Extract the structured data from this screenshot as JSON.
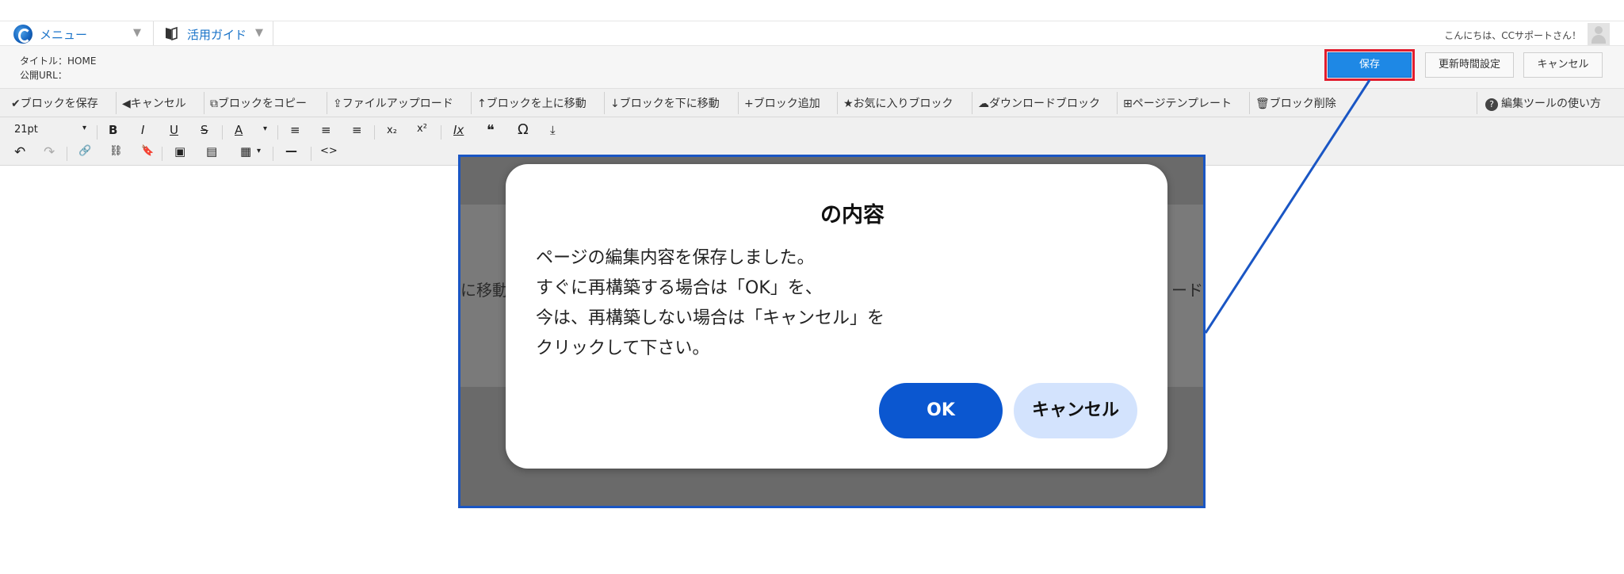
{
  "topbar": {
    "menu_label": "メニュー",
    "guide_label": "活用ガイド",
    "caret": "▼",
    "greeting": "こんにちは、CCサポートさん！"
  },
  "page_info": {
    "title_line": "タイトル：HOME",
    "url_line": "公開URL："
  },
  "actions": {
    "save": "保存",
    "update_time": "更新時間設定",
    "cancel": "キャンセル"
  },
  "block_toolbar": {
    "items": [
      {
        "icon": "✔",
        "label": "ブロックを保存"
      },
      {
        "icon": "◀",
        "label": "キャンセル"
      },
      {
        "icon": "⧉",
        "label": "ブロックをコピー"
      },
      {
        "icon": "⇪",
        "label": "ファイルアップロード"
      },
      {
        "icon": "↑",
        "label": "ブロックを上に移動"
      },
      {
        "icon": "↓",
        "label": "ブロックを下に移動"
      },
      {
        "icon": "+",
        "label": "ブロック追加"
      },
      {
        "icon": "★",
        "label": "お気に入りブロック"
      },
      {
        "icon": "☁",
        "label": "ダウンロードブロック"
      },
      {
        "icon": "⊞",
        "label": "ページテンプレート"
      },
      {
        "icon": "🗑",
        "label": "ブロック削除"
      }
    ],
    "help": {
      "icon": "?",
      "label": "編集ツールの使い方"
    }
  },
  "editor_toolbar": {
    "font_size": "21pt",
    "row1": [
      "B",
      "I",
      "U",
      "S",
      "A",
      "≡",
      "≡",
      "≡",
      "x₂",
      "x²",
      "Ix",
      "❝",
      "Ω",
      "⤓"
    ],
    "row2": [
      "↶",
      "↷",
      "🔗",
      "⛓",
      "🔖",
      "▣",
      "▤",
      "▦",
      "—",
      "<>"
    ]
  },
  "overlay": {
    "bg_left_text": "に移動",
    "bg_right_text": "ード"
  },
  "dialog": {
    "title": "の内容",
    "message_lines": [
      "ページの編集内容を保存しました。",
      "すぐに再構築する場合は「OK」を、",
      "今は、再構築しない場合は「キャンセル」を",
      "クリックして下さい。"
    ],
    "ok_label": "OK",
    "cancel_label": "キャンセル"
  },
  "colors": {
    "accent_blue": "#1e88e5",
    "highlight_red": "#e11d2e",
    "callout_blue": "#1a56c4",
    "ok_button": "#0b57d0",
    "cancel_button": "#d3e3fd"
  }
}
